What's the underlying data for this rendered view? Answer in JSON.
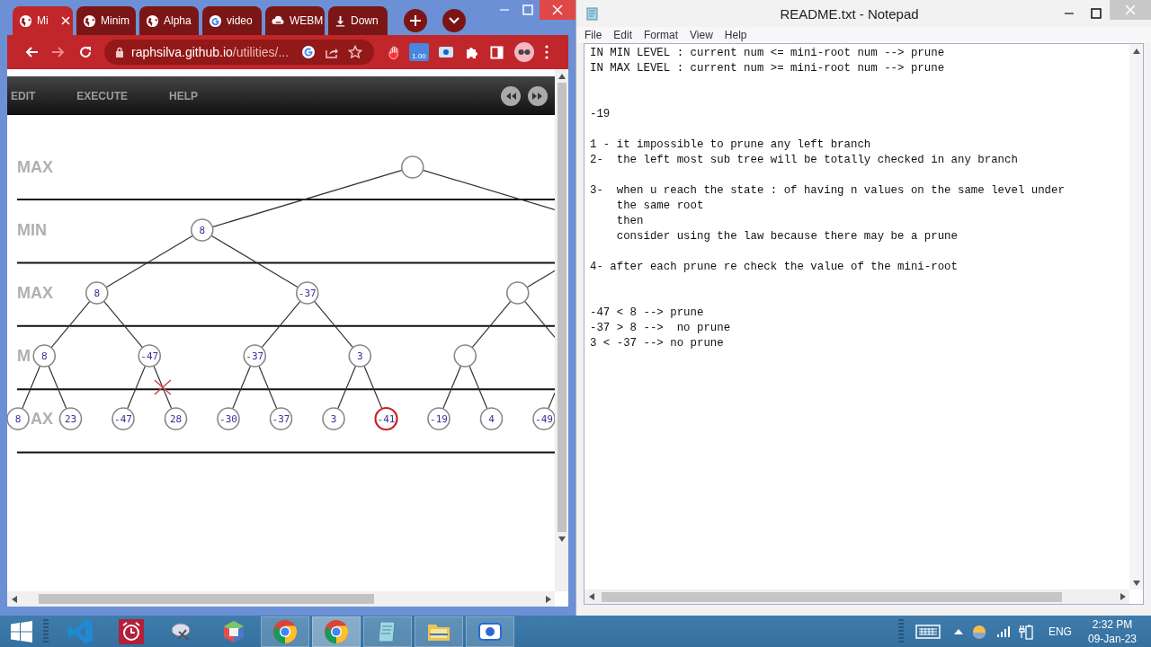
{
  "browser": {
    "tabs": [
      {
        "kind": "globe",
        "title": "Mi",
        "selected": true
      },
      {
        "kind": "globe",
        "title": "Minim",
        "selected": false
      },
      {
        "kind": "globe",
        "title": "Alpha",
        "selected": false
      },
      {
        "kind": "google",
        "title": "video",
        "selected": false
      },
      {
        "kind": "cloud",
        "title": "WEBM",
        "selected": false
      },
      {
        "kind": "download",
        "title": "Down",
        "selected": false
      }
    ],
    "address": {
      "host": "raphsilva.github.io",
      "path": "/utilities/..."
    },
    "extension_badge": "1.00",
    "page": {
      "menu": [
        "EDIT",
        "EXECUTE",
        "HELP"
      ],
      "tree": {
        "levels": [
          "MAX",
          "MIN",
          "MAX",
          "M",
          "AX"
        ],
        "root": {
          "children": [
            {
              "value": "8",
              "children": [
                {
                  "value": "8",
                  "children": [
                    {
                      "value": "8",
                      "children": [
                        {
                          "value": "8"
                        },
                        {
                          "value": "23"
                        }
                      ]
                    },
                    {
                      "value": "-47",
                      "children": [
                        {
                          "value": "-47"
                        },
                        {
                          "value": "28",
                          "pruned": true
                        }
                      ]
                    }
                  ]
                },
                {
                  "value": "-37",
                  "children": [
                    {
                      "value": "-37",
                      "children": [
                        {
                          "value": "-30"
                        },
                        {
                          "value": "-37"
                        }
                      ]
                    },
                    {
                      "value": "3",
                      "children": [
                        {
                          "value": "3"
                        },
                        {
                          "value": "-41",
                          "highlighted": true
                        }
                      ]
                    }
                  ]
                }
              ]
            },
            {
              "children": [
                {
                  "children": [
                    {
                      "children": [
                        {
                          "value": "-19"
                        },
                        {
                          "value": "4"
                        }
                      ]
                    },
                    {
                      "children": [
                        {
                          "value": "-49"
                        }
                      ]
                    }
                  ]
                }
              ]
            }
          ]
        }
      }
    }
  },
  "notepad": {
    "title": "README.txt - Notepad",
    "menu": [
      "File",
      "Edit",
      "Format",
      "View",
      "Help"
    ],
    "text": "IN MIN LEVEL : current num <= mini-root num --> prune\nIN MAX LEVEL : current num >= mini-root num --> prune\n\n\n-19\n\n1 - it impossible to prune any left branch\n2-  the left most sub tree will be totally checked in any branch\n\n3-  when u reach the state : of having n values on the same level under\n    the same root\n    then\n    consider using the law because there may be a prune\n\n4- after each prune re check the value of the mini-root\n\n\n-47 < 8 --> prune\n-37 > 8 -->  no prune\n3 < -37 --> no prune"
  },
  "taskbar": {
    "apps": [
      {
        "kind": "vscode",
        "running": false,
        "selected": false
      },
      {
        "kind": "alarm",
        "running": false,
        "selected": false
      },
      {
        "kind": "snip",
        "running": false,
        "selected": false
      },
      {
        "kind": "cube",
        "running": false,
        "selected": false
      },
      {
        "kind": "chrome",
        "running": true,
        "selected": false
      },
      {
        "kind": "chrome",
        "running": true,
        "selected": true
      },
      {
        "kind": "notepad",
        "running": true,
        "selected": false
      },
      {
        "kind": "folder",
        "running": true,
        "selected": false
      },
      {
        "kind": "camera",
        "running": true,
        "selected": false
      }
    ],
    "language": "ENG",
    "time": "2:32 PM",
    "date": "09-Jan-23"
  }
}
